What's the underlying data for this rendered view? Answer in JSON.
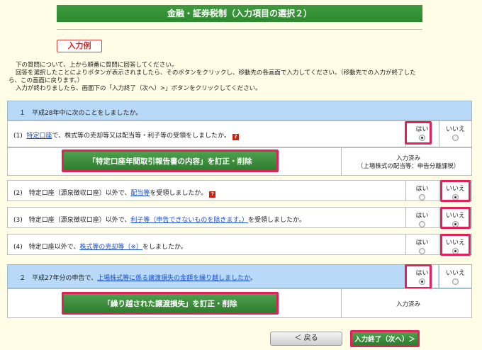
{
  "header": {
    "title": "金融・証券税制（入力項目の選択２）"
  },
  "example_button": "入力例",
  "instructions": [
    "下の質問について、上から順番に質問に回答してください。",
    "回答を選択したことによりボタンが表示されましたら、そのボタンをクリックし、移動先の各画面で入力してください。（移動先での入力が終了した",
    "ら、この画面に戻ります。）",
    "入力が終わりましたら、画面下の「入力終了（次へ）>」ボタンをクリックしてください。"
  ],
  "choices": {
    "yes": "はい",
    "no": "いいえ"
  },
  "section1": {
    "header": "１　平成28年中に次のことをしましたか。",
    "q1": {
      "prefix": "(1)",
      "link": "特定口座",
      "text": "で、株式等の売却等又は配当等・利子等の受領をしましたか。",
      "help": "?",
      "selected": "yes"
    },
    "q1_button": "「特定口座年間取引報告書の内容」を訂正・削除",
    "q1_status": [
      "入力済み",
      "（上場株式の配当等：申告分離課税）"
    ],
    "q2": {
      "prefix": "(2)　特定口座（源泉徴収口座）以外で、",
      "link": "配当等",
      "text": "を受領しましたか。",
      "help": "?",
      "selected": "no"
    },
    "q3": {
      "prefix": "(3)　特定口座（源泉徴収口座）以外で、",
      "link": "利子等（申告できないものを除きます。）",
      "text": "を受領しましたか。",
      "selected": "no"
    },
    "q4": {
      "prefix": "(4)　特定口座以外で、",
      "link": "株式等の売却等（※）",
      "text": "をしましたか。",
      "selected": "no"
    }
  },
  "section2": {
    "prefix": "２　平成27年分の申告で、",
    "link": "上場株式等に係る譲渡損失の金額を繰り越しましたか",
    "suffix": "。",
    "selected": "yes",
    "button": "「繰り越された譲渡損失」を訂正・削除",
    "status": "入力済み"
  },
  "footer": {
    "back_label": "＜ 戻る",
    "finish_label": "入力終了（次へ）＞"
  }
}
